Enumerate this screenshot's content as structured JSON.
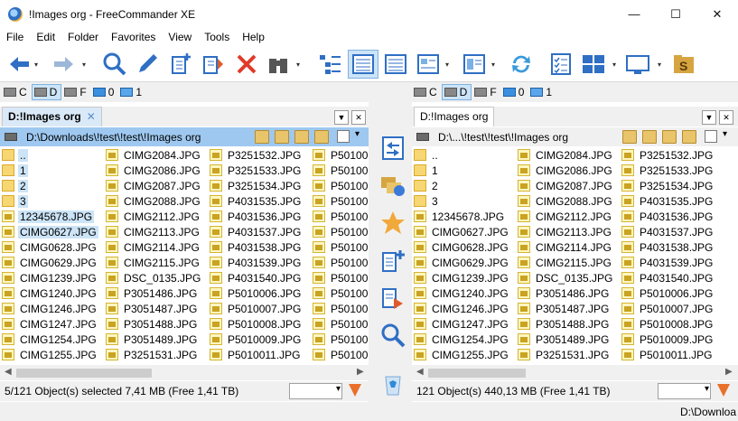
{
  "window": {
    "title": "!Images org - FreeCommander XE"
  },
  "menu": [
    "File",
    "Edit",
    "Folder",
    "Favorites",
    "View",
    "Tools",
    "Help"
  ],
  "toolbar": {
    "buttons": [
      "back-icon",
      "forward-icon",
      "search-icon",
      "edit-icon",
      "new-file-icon",
      "copy-icon",
      "delete-icon",
      "binoculars-icon",
      "tree-view-icon",
      "details-view-icon",
      "list-view-icon",
      "thumbnail-view-icon",
      "layout-view-icon",
      "sync-icon",
      "checklist-icon",
      "panels-icon",
      "desktop-icon",
      "dollar-folder-icon"
    ]
  },
  "left": {
    "drives": [
      {
        "letter": "C",
        "active": false
      },
      {
        "letter": "D",
        "active": true
      },
      {
        "letter": "F",
        "active": false
      },
      {
        "letter": "0",
        "active": false
      },
      {
        "letter": "1",
        "active": false
      }
    ],
    "tab": "D:!Images org",
    "tab_close": "✕",
    "path": "D:\\Downloads\\!test\\!test\\!Images org",
    "columns": [
      [
        {
          "name": "..",
          "type": "folder",
          "selected": true
        },
        {
          "name": "1",
          "type": "folder",
          "selected": true
        },
        {
          "name": "2",
          "type": "folder",
          "selected": true
        },
        {
          "name": "3",
          "type": "folder",
          "selected": true
        },
        {
          "name": "12345678.JPG",
          "type": "jpg",
          "selected": true
        },
        {
          "name": "CIMG0627.JPG",
          "type": "jpg",
          "selected": true
        },
        {
          "name": "CIMG0628.JPG",
          "type": "jpg",
          "selected": false
        },
        {
          "name": "CIMG0629.JPG",
          "type": "jpg",
          "selected": false
        },
        {
          "name": "CIMG1239.JPG",
          "type": "jpg",
          "selected": false
        },
        {
          "name": "CIMG1240.JPG",
          "type": "jpg",
          "selected": false
        },
        {
          "name": "CIMG1246.JPG",
          "type": "jpg",
          "selected": false
        },
        {
          "name": "CIMG1247.JPG",
          "type": "jpg",
          "selected": false
        },
        {
          "name": "CIMG1254.JPG",
          "type": "jpg",
          "selected": false
        },
        {
          "name": "CIMG1255.JPG",
          "type": "jpg",
          "selected": false
        }
      ],
      [
        {
          "name": "CIMG2084.JPG"
        },
        {
          "name": "CIMG2086.JPG"
        },
        {
          "name": "CIMG2087.JPG"
        },
        {
          "name": "CIMG2088.JPG"
        },
        {
          "name": "CIMG2112.JPG"
        },
        {
          "name": "CIMG2113.JPG"
        },
        {
          "name": "CIMG2114.JPG"
        },
        {
          "name": "CIMG2115.JPG"
        },
        {
          "name": "DSC_0135.JPG"
        },
        {
          "name": "P3051486.JPG"
        },
        {
          "name": "P3051487.JPG"
        },
        {
          "name": "P3051488.JPG"
        },
        {
          "name": "P3051489.JPG"
        },
        {
          "name": "P3251531.JPG"
        }
      ],
      [
        {
          "name": "P3251532.JPG"
        },
        {
          "name": "P3251533.JPG"
        },
        {
          "name": "P3251534.JPG"
        },
        {
          "name": "P4031535.JPG"
        },
        {
          "name": "P4031536.JPG"
        },
        {
          "name": "P4031537.JPG"
        },
        {
          "name": "P4031538.JPG"
        },
        {
          "name": "P4031539.JPG"
        },
        {
          "name": "P4031540.JPG"
        },
        {
          "name": "P5010006.JPG"
        },
        {
          "name": "P5010007.JPG"
        },
        {
          "name": "P5010008.JPG"
        },
        {
          "name": "P5010009.JPG"
        },
        {
          "name": "P5010011.JPG"
        }
      ],
      [
        {
          "name": "P50100"
        },
        {
          "name": "P50100"
        },
        {
          "name": "P50100"
        },
        {
          "name": "P50100"
        },
        {
          "name": "P50100"
        },
        {
          "name": "P50100"
        },
        {
          "name": "P50100"
        },
        {
          "name": "P50100"
        },
        {
          "name": "P50100"
        },
        {
          "name": "P50100"
        },
        {
          "name": "P50100"
        },
        {
          "name": "P50100"
        },
        {
          "name": "P50100"
        },
        {
          "name": "P50100"
        }
      ]
    ],
    "status": "5/121 Object(s) selected    7,41 MB    (Free 1,41 TB)"
  },
  "right": {
    "drives": [
      {
        "letter": "C",
        "active": false
      },
      {
        "letter": "D",
        "active": true
      },
      {
        "letter": "F",
        "active": false
      },
      {
        "letter": "0",
        "active": false
      },
      {
        "letter": "1",
        "active": false
      }
    ],
    "tab": "D:!Images org",
    "path": "D:\\...\\!test\\!test\\!Images org",
    "columns": [
      [
        {
          "name": "..",
          "type": "folder"
        },
        {
          "name": "1",
          "type": "folder"
        },
        {
          "name": "2",
          "type": "folder"
        },
        {
          "name": "3",
          "type": "folder"
        },
        {
          "name": "12345678.JPG",
          "type": "jpg"
        },
        {
          "name": "CIMG0627.JPG",
          "type": "jpg"
        },
        {
          "name": "CIMG0628.JPG",
          "type": "jpg"
        },
        {
          "name": "CIMG0629.JPG",
          "type": "jpg"
        },
        {
          "name": "CIMG1239.JPG",
          "type": "jpg"
        },
        {
          "name": "CIMG1240.JPG",
          "type": "jpg"
        },
        {
          "name": "CIMG1246.JPG",
          "type": "jpg"
        },
        {
          "name": "CIMG1247.JPG",
          "type": "jpg"
        },
        {
          "name": "CIMG1254.JPG",
          "type": "jpg"
        },
        {
          "name": "CIMG1255.JPG",
          "type": "jpg"
        }
      ],
      [
        {
          "name": "CIMG2084.JPG"
        },
        {
          "name": "CIMG2086.JPG"
        },
        {
          "name": "CIMG2087.JPG"
        },
        {
          "name": "CIMG2088.JPG"
        },
        {
          "name": "CIMG2112.JPG"
        },
        {
          "name": "CIMG2113.JPG"
        },
        {
          "name": "CIMG2114.JPG"
        },
        {
          "name": "CIMG2115.JPG"
        },
        {
          "name": "DSC_0135.JPG"
        },
        {
          "name": "P3051486.JPG"
        },
        {
          "name": "P3051487.JPG"
        },
        {
          "name": "P3051488.JPG"
        },
        {
          "name": "P3051489.JPG"
        },
        {
          "name": "P3251531.JPG"
        }
      ],
      [
        {
          "name": "P3251532.JPG"
        },
        {
          "name": "P3251533.JPG"
        },
        {
          "name": "P3251534.JPG"
        },
        {
          "name": "P4031535.JPG"
        },
        {
          "name": "P4031536.JPG"
        },
        {
          "name": "P4031537.JPG"
        },
        {
          "name": "P4031538.JPG"
        },
        {
          "name": "P4031539.JPG"
        },
        {
          "name": "P4031540.JPG"
        },
        {
          "name": "P5010006.JPG"
        },
        {
          "name": "P5010007.JPG"
        },
        {
          "name": "P5010008.JPG"
        },
        {
          "name": "P5010009.JPG"
        },
        {
          "name": "P5010011.JPG"
        }
      ]
    ],
    "status": "121 Object(s)    440,13 MB    (Free 1,41 TB)"
  },
  "bottom_path": "D:\\Downloa",
  "colors": {
    "accent": "#9ec8f0",
    "selection": "#cce4f7",
    "folder": "#f7d774"
  }
}
